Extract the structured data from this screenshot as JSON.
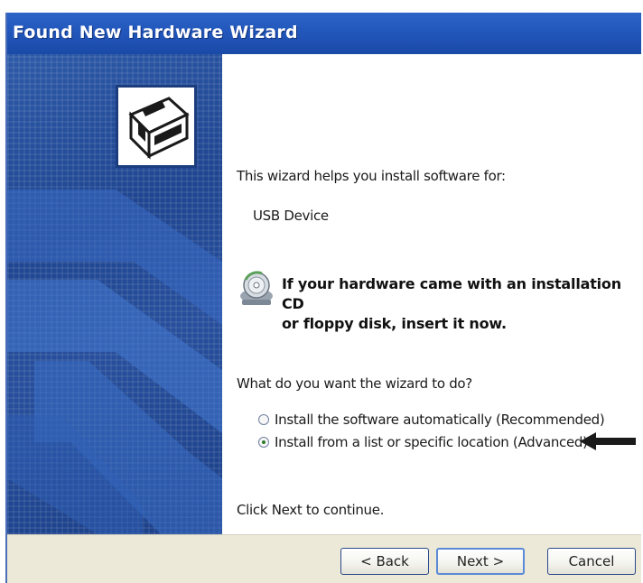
{
  "window": {
    "title": "Found New Hardware Wizard"
  },
  "content": {
    "intro": "This wizard helps you install software for:",
    "device_name": "USB Device",
    "cd_prompt_line1": "If your hardware came with an installation CD",
    "cd_prompt_line2": "or floppy disk, insert it now.",
    "question": "What do you want the wizard to do?",
    "options": [
      {
        "label": "Install the software automatically (Recommended)",
        "selected": false
      },
      {
        "label": "Install from a list or specific location (Advanced)",
        "selected": true
      }
    ],
    "continue_hint": "Click Next to continue."
  },
  "buttons": {
    "back": "< Back",
    "next": "Next >",
    "cancel": "Cancel"
  },
  "icons": {
    "hardware": "hardware-box-icon",
    "cd": "cd-icon",
    "arrow": "left-arrow-icon"
  },
  "colors": {
    "title_bar": "#2358bd",
    "left_panel": "#1f4590",
    "button_bar": "#ece9d8"
  }
}
